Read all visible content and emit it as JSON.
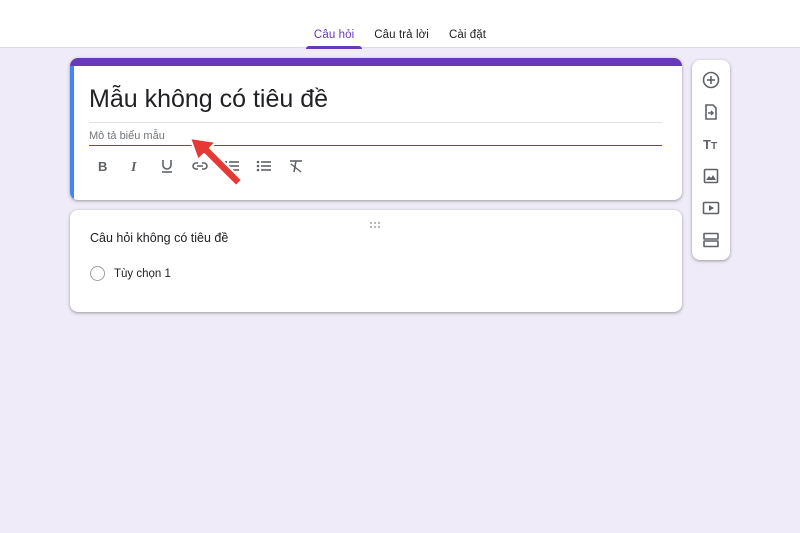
{
  "tabs": [
    {
      "label": "Câu hỏi",
      "active": true
    },
    {
      "label": "Câu trả lời",
      "active": false
    },
    {
      "label": "Cài đặt",
      "active": false
    }
  ],
  "form": {
    "title": "Mẫu không có tiêu đề",
    "description_placeholder": "Mô tả biểu mẫu",
    "format_buttons": [
      "bold-icon",
      "italic-icon",
      "underline-icon",
      "link-icon",
      "numbered-list-icon",
      "bulleted-list-icon",
      "clear-format-icon"
    ]
  },
  "question": {
    "title": "Câu hỏi không có tiêu đề",
    "options": [
      "Tùy chọn 1"
    ]
  },
  "side_toolbar": [
    "add-question-icon",
    "import-questions-icon",
    "add-title-icon",
    "add-image-icon",
    "add-video-icon",
    "add-section-icon"
  ],
  "colors": {
    "accent": "#673ab7",
    "background": "#f0ebf8",
    "active_card_bar": "#4285f4",
    "annotation_arrow": "#e53935"
  }
}
